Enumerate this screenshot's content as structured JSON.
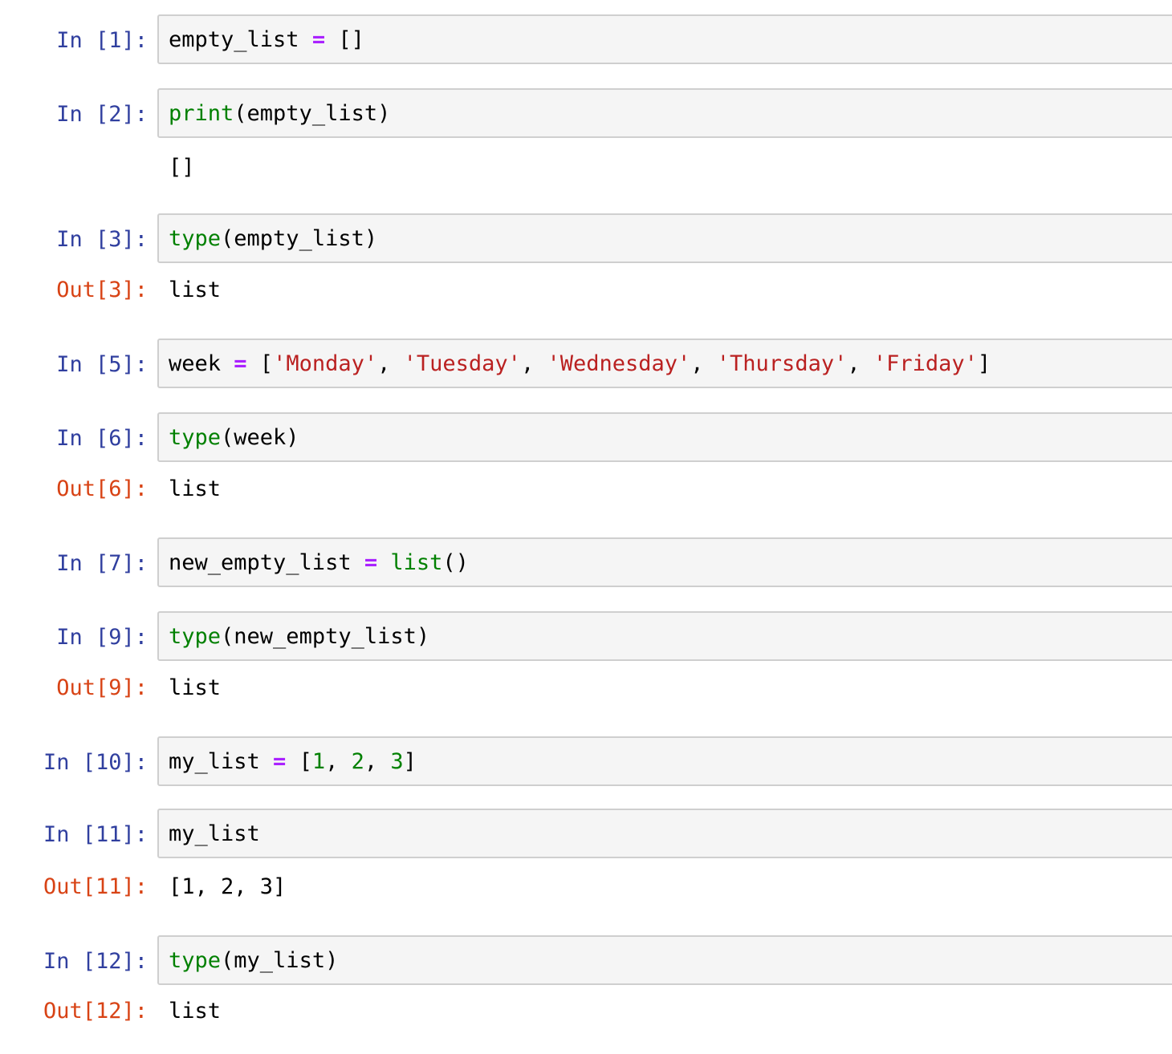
{
  "cells": [
    {
      "in_prompt": "In [1]:",
      "code": [
        {
          "t": "empty_list ",
          "c": "plain"
        },
        {
          "t": "=",
          "c": "op"
        },
        {
          "t": " []",
          "c": "plain"
        }
      ]
    },
    {
      "in_prompt": "In [2]:",
      "code": [
        {
          "t": "print",
          "c": "builtin"
        },
        {
          "t": "(empty_list)",
          "c": "plain"
        }
      ],
      "stdout": "[]"
    },
    {
      "in_prompt": "In [3]:",
      "code": [
        {
          "t": "type",
          "c": "builtin"
        },
        {
          "t": "(empty_list)",
          "c": "plain"
        }
      ],
      "out_prompt": "Out[3]:",
      "output": "list"
    },
    {
      "in_prompt": "In [5]:",
      "code": [
        {
          "t": "week ",
          "c": "plain"
        },
        {
          "t": "=",
          "c": "op"
        },
        {
          "t": " [",
          "c": "plain"
        },
        {
          "t": "'Monday'",
          "c": "str"
        },
        {
          "t": ", ",
          "c": "plain"
        },
        {
          "t": "'Tuesday'",
          "c": "str"
        },
        {
          "t": ", ",
          "c": "plain"
        },
        {
          "t": "'Wednesday'",
          "c": "str"
        },
        {
          "t": ", ",
          "c": "plain"
        },
        {
          "t": "'Thursday'",
          "c": "str"
        },
        {
          "t": ", ",
          "c": "plain"
        },
        {
          "t": "'Friday'",
          "c": "str"
        },
        {
          "t": "]",
          "c": "plain"
        }
      ]
    },
    {
      "in_prompt": "In [6]:",
      "code": [
        {
          "t": "type",
          "c": "builtin"
        },
        {
          "t": "(week)",
          "c": "plain"
        }
      ],
      "out_prompt": "Out[6]:",
      "output": "list"
    },
    {
      "in_prompt": "In [7]:",
      "code": [
        {
          "t": "new_empty_list ",
          "c": "plain"
        },
        {
          "t": "=",
          "c": "op"
        },
        {
          "t": " ",
          "c": "plain"
        },
        {
          "t": "list",
          "c": "builtin"
        },
        {
          "t": "()",
          "c": "plain"
        }
      ]
    },
    {
      "in_prompt": "In [9]:",
      "code": [
        {
          "t": "type",
          "c": "builtin"
        },
        {
          "t": "(new_empty_list)",
          "c": "plain"
        }
      ],
      "out_prompt": "Out[9]:",
      "output": "list"
    },
    {
      "in_prompt": "In [10]:",
      "code": [
        {
          "t": "my_list ",
          "c": "plain"
        },
        {
          "t": "=",
          "c": "op"
        },
        {
          "t": " [",
          "c": "plain"
        },
        {
          "t": "1",
          "c": "num"
        },
        {
          "t": ", ",
          "c": "plain"
        },
        {
          "t": "2",
          "c": "num"
        },
        {
          "t": ", ",
          "c": "plain"
        },
        {
          "t": "3",
          "c": "num"
        },
        {
          "t": "]",
          "c": "plain"
        }
      ]
    },
    {
      "in_prompt": "In [11]:",
      "code": [
        {
          "t": "my_list",
          "c": "plain"
        }
      ],
      "out_prompt": "Out[11]:",
      "output": "[1, 2, 3]"
    },
    {
      "in_prompt": "In [12]:",
      "code": [
        {
          "t": "type",
          "c": "builtin"
        },
        {
          "t": "(my_list)",
          "c": "plain"
        }
      ],
      "out_prompt": "Out[12]:",
      "output": "list"
    }
  ],
  "colors": {
    "in_prompt": "#303f9f",
    "out_prompt": "#d84315",
    "builtin": "#008000",
    "operator": "#aa22ff",
    "string": "#ba2121",
    "number": "#008000",
    "cell_background": "#f5f5f5"
  }
}
